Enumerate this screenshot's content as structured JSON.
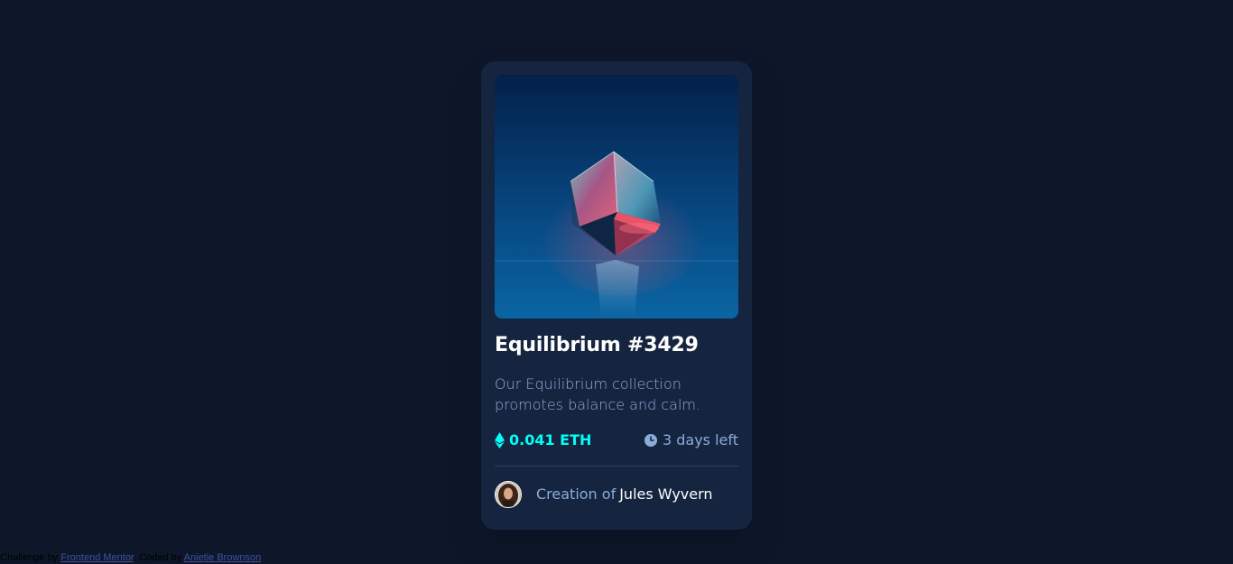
{
  "card": {
    "title": "Equilibrium #3429",
    "description": "Our Equilibrium collection promotes balance and calm.",
    "price": "0.041 ETH",
    "time_left": "3 days left",
    "creator_prefix": "Creation of",
    "creator_name": "Jules Wyvern"
  },
  "icons": {
    "price": "ethereum-icon",
    "time": "clock-icon"
  },
  "attribution": {
    "prefix": "Challenge by",
    "mentor_link": "Frontend Mentor",
    "separator": ". Coded by",
    "author_link": "Anietie Brownson"
  },
  "colors": {
    "background": "#0d1729",
    "card": "#15253f",
    "accent_cyan": "#00fff8",
    "text_soft_blue": "#8bacd9",
    "white": "#ffffff",
    "divider": "#2e405a"
  }
}
